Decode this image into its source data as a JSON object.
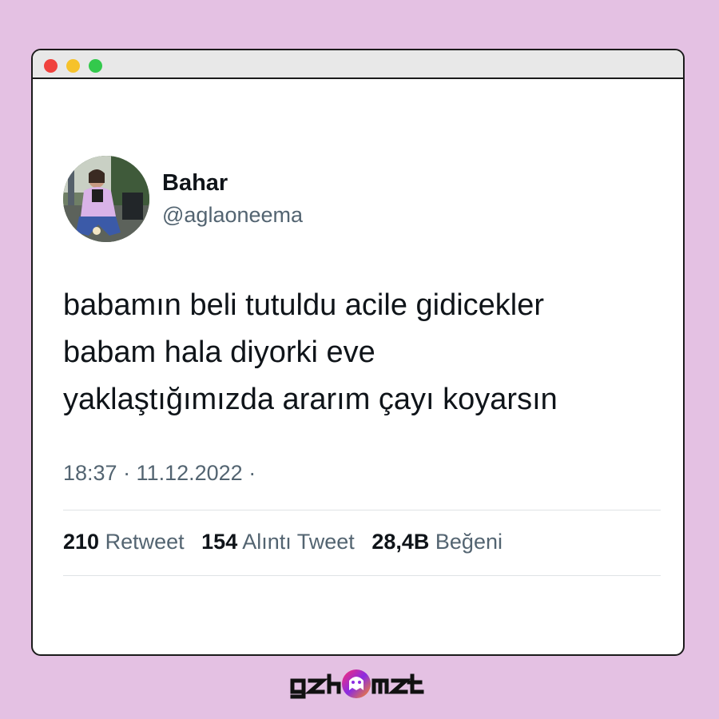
{
  "window": {
    "controls": [
      "close",
      "minimize",
      "maximize"
    ],
    "colors": {
      "close": "#f0423d",
      "minimize": "#f6c22b",
      "maximize": "#33c94c"
    }
  },
  "tweet": {
    "display_name": "Bahar",
    "handle": "@aglaoneema",
    "avatar_icon": "profile-photo",
    "text_lines": [
      "babamın beli tutuldu acile gidicekler",
      "babam hala diyorki eve",
      "yaklaştığımızda ararım çayı koyarsın"
    ],
    "meta": "18:37 · 11.12.2022 ·",
    "stats": [
      {
        "num": "210",
        "label": "Retweet"
      },
      {
        "num": "154",
        "label": "Alıntı Tweet"
      },
      {
        "num": "28,4B",
        "label": "Beğeni"
      }
    ]
  },
  "branding": {
    "logo_text": "gzhmzt",
    "logo_colors": [
      "#ff2d6f",
      "#8a2be2",
      "#ff8c1a"
    ]
  }
}
